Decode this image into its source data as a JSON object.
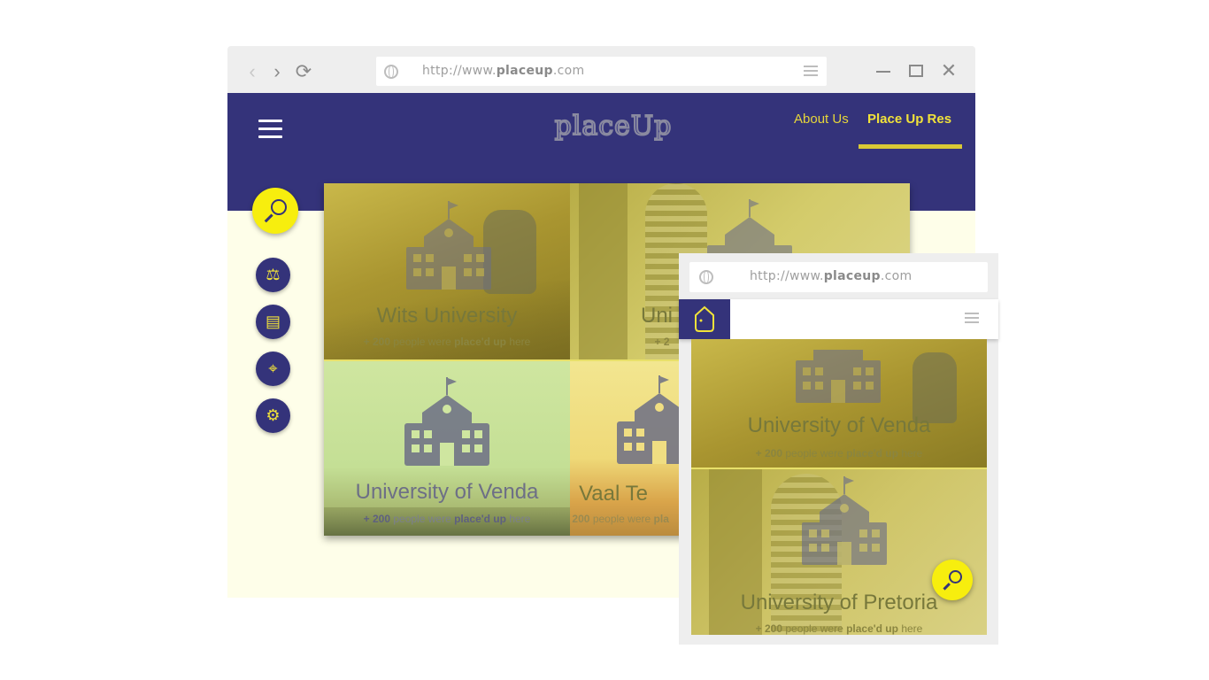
{
  "desktop_browser": {
    "url_prefix": "http://www.",
    "url_domain": "placeup",
    "url_suffix": ".com",
    "nav": {
      "back": "‹",
      "forward": "›",
      "reload": "⟳"
    },
    "window": {
      "close": "✕"
    }
  },
  "site_header": {
    "logo_text": "placeUp",
    "nav_items": [
      {
        "label": "About Us",
        "active": false
      },
      {
        "label": "Place Up Res",
        "active": true
      }
    ]
  },
  "sidebar": {
    "icons": [
      {
        "name": "scales-icon",
        "glyph": "⚖"
      },
      {
        "name": "notepad-icon",
        "glyph": "▤"
      },
      {
        "name": "location-pin-icon",
        "glyph": "⌖"
      },
      {
        "name": "settings-icon",
        "glyph": "⚙"
      }
    ]
  },
  "tiles": [
    {
      "name": "Wits University",
      "count": "+ 200",
      "mid": "people were",
      "bold": "place'd up",
      "end": "here"
    },
    {
      "name": "Uni",
      "count": "+ 2",
      "mid": "",
      "bold": "",
      "end": ""
    },
    {
      "name": "University of Venda",
      "count": "+ 200",
      "mid": "people were",
      "bold": "place'd up",
      "end": "here"
    },
    {
      "name": "Vaal Te",
      "count": "+ 200",
      "mid": "people were",
      "bold": "pla",
      "end": ""
    }
  ],
  "mobile": {
    "url_prefix": "http://www.",
    "url_domain": "placeup",
    "url_suffix": ".com",
    "cards": [
      {
        "name": "University of Venda",
        "count": "+ 200",
        "mid": "people were",
        "bold": "place'd up",
        "end": "here"
      },
      {
        "name": "University of Pretoria",
        "count": "+ 200",
        "mid": "people were",
        "bold": "place'd up",
        "end": "here"
      }
    ]
  },
  "colors": {
    "brand_navy": "#34337a",
    "accent_yellow": "#f7ee0e",
    "nav_yellow": "#e6d63a"
  }
}
